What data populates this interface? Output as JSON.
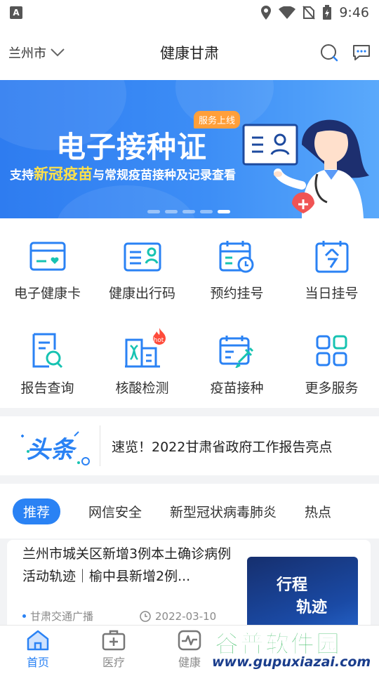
{
  "status_bar": {
    "time": "9:46",
    "app_badge": "A"
  },
  "header": {
    "city": "兰州市",
    "title": "健康甘肃",
    "icons": [
      "search-icon",
      "message-icon"
    ]
  },
  "banner": {
    "badge": "服务上线",
    "title": "电子接种证",
    "subtitle_prefix": "支持",
    "subtitle_highlight": "新冠疫苗",
    "subtitle_suffix": "与常规疫苗接种及记录查看",
    "slide_count": 5,
    "active_slide": 5
  },
  "services": [
    {
      "label": "电子健康卡",
      "icon": "health-card-icon"
    },
    {
      "label": "健康出行码",
      "icon": "travel-code-icon"
    },
    {
      "label": "预约挂号",
      "icon": "appointment-icon"
    },
    {
      "label": "当日挂号",
      "icon": "today-register-icon"
    },
    {
      "label": "报告查询",
      "icon": "report-search-icon"
    },
    {
      "label": "核酸检测",
      "icon": "nucleic-test-icon",
      "badge": "hot"
    },
    {
      "label": "疫苗接种",
      "icon": "vaccine-icon"
    },
    {
      "label": "更多服务",
      "icon": "more-services-icon"
    }
  ],
  "headline": {
    "logo_text": "头条",
    "text": "速览！2022甘肃省政府工作报告亮点"
  },
  "tabs": [
    "推荐",
    "网信安全",
    "新型冠状病毒肺炎",
    "热点"
  ],
  "active_tab": 0,
  "news": {
    "title": "兰州市城关区新增3例本土确诊病例活动轨迹｜榆中县新增2例...",
    "source": "甘肃交通广播",
    "date": "2022-03-10",
    "thumb_line1": "行程",
    "thumb_line2": "轨迹"
  },
  "bottom_nav": [
    {
      "label": "首页",
      "icon": "home-icon"
    },
    {
      "label": "医疗",
      "icon": "medical-kit-icon"
    },
    {
      "label": "健康",
      "icon": "pulse-icon"
    },
    {
      "label": "",
      "icon": ""
    },
    {
      "label": "",
      "icon": ""
    }
  ],
  "active_nav": 0,
  "watermark": {
    "text": "谷普软件园",
    "url": "www.gupuxiazai.com"
  },
  "colors": {
    "accent": "#2a82f4",
    "banner_blue": "#3d8ef6",
    "highlight_yellow": "#ffe14a",
    "badge_orange": "#ff9f3a"
  }
}
